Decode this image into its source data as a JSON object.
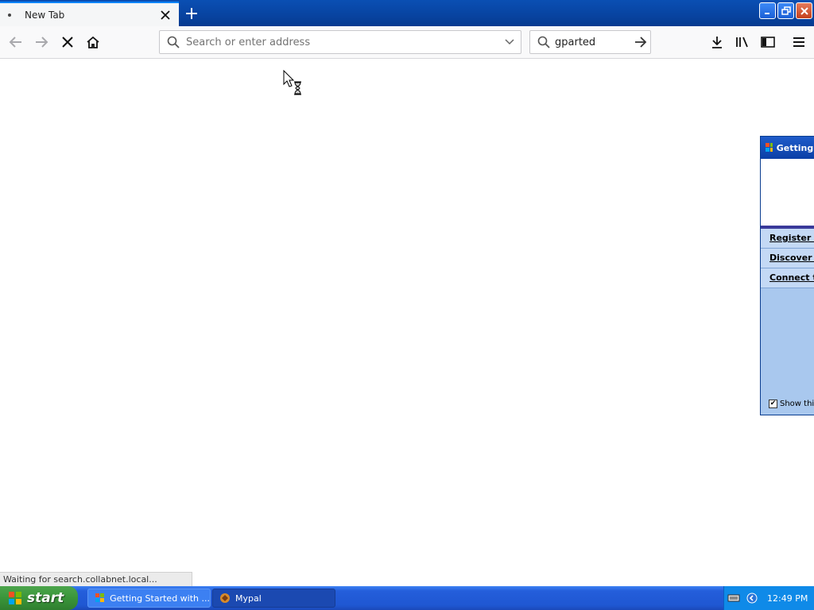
{
  "browser": {
    "tab": {
      "title": "New Tab"
    },
    "urlbar": {
      "placeholder": "Search or enter address",
      "value": ""
    },
    "searchbar": {
      "value": "gparted"
    },
    "status": "Waiting for search.collabnet.local..."
  },
  "getting_started_window": {
    "title": "Getting S",
    "links": [
      "Register N",
      "Discover V",
      "Connect to"
    ],
    "show_checkbox_label": "Show this",
    "show_checked": true
  },
  "taskbar": {
    "start_label": "start",
    "tasks": [
      {
        "label": "Getting Started with ...",
        "active": false
      },
      {
        "label": "Mypal",
        "active": true
      }
    ],
    "clock": "12:49 PM"
  }
}
